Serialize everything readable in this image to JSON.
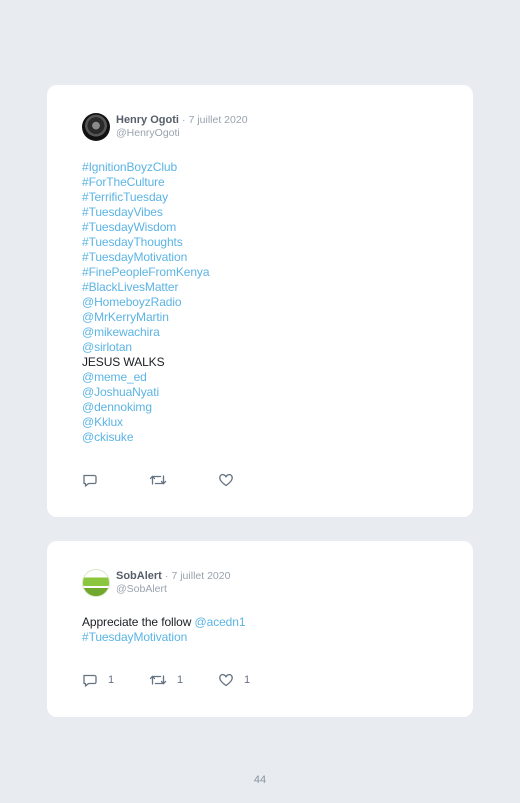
{
  "tweets": [
    {
      "author_name": "Henry Ogoti",
      "separator": "·",
      "date": "7 juillet 2020",
      "handle": "@HenryOgoti",
      "lines": [
        {
          "text": "#IgnitionBoyzClub",
          "kind": "link"
        },
        {
          "text": "#ForTheCulture",
          "kind": "link"
        },
        {
          "text": "#TerrificTuesday",
          "kind": "link"
        },
        {
          "text": "#TuesdayVibes",
          "kind": "link"
        },
        {
          "text": "#TuesdayWisdom",
          "kind": "link"
        },
        {
          "text": "#TuesdayThoughts",
          "kind": "link"
        },
        {
          "text": "#TuesdayMotivation",
          "kind": "link"
        },
        {
          "text": "#FinePeopleFromKenya",
          "kind": "link"
        },
        {
          "text": "#BlackLivesMatter",
          "kind": "link"
        },
        {
          "text": "@HomeboyzRadio",
          "kind": "link"
        },
        {
          "text": "@MrKerryMartin",
          "kind": "link"
        },
        {
          "text": "@mikewachira",
          "kind": "link"
        },
        {
          "text": "@sirlotan",
          "kind": "link"
        },
        {
          "text": "JESUS WALKS",
          "kind": "plain"
        },
        {
          "text": "@meme_ed",
          "kind": "link"
        },
        {
          "text": "@JoshuaNyati",
          "kind": "link"
        },
        {
          "text": "@dennokimg",
          "kind": "link"
        },
        {
          "text": "@Kklux",
          "kind": "link"
        },
        {
          "text": "@ckisuke",
          "kind": "link"
        }
      ],
      "replies": "",
      "retweets": "",
      "likes": ""
    },
    {
      "author_name": "SobAlert",
      "separator": "·",
      "date": "7 juillet 2020",
      "handle": "@SobAlert",
      "line1_plain": "Appreciate the follow ",
      "line1_link": "@acedn1",
      "line2_link": "#TuesdayMotivation",
      "replies": "1",
      "retweets": "1",
      "likes": "1"
    }
  ],
  "icons": {
    "reply": "reply-icon",
    "retweet": "retweet-icon",
    "like": "heart-icon"
  },
  "colors": {
    "background": "#e8ecf1",
    "card": "#ffffff",
    "link": "#5bb4e4",
    "muted": "#99a2ad",
    "icon": "#657281"
  },
  "page_number": "44"
}
